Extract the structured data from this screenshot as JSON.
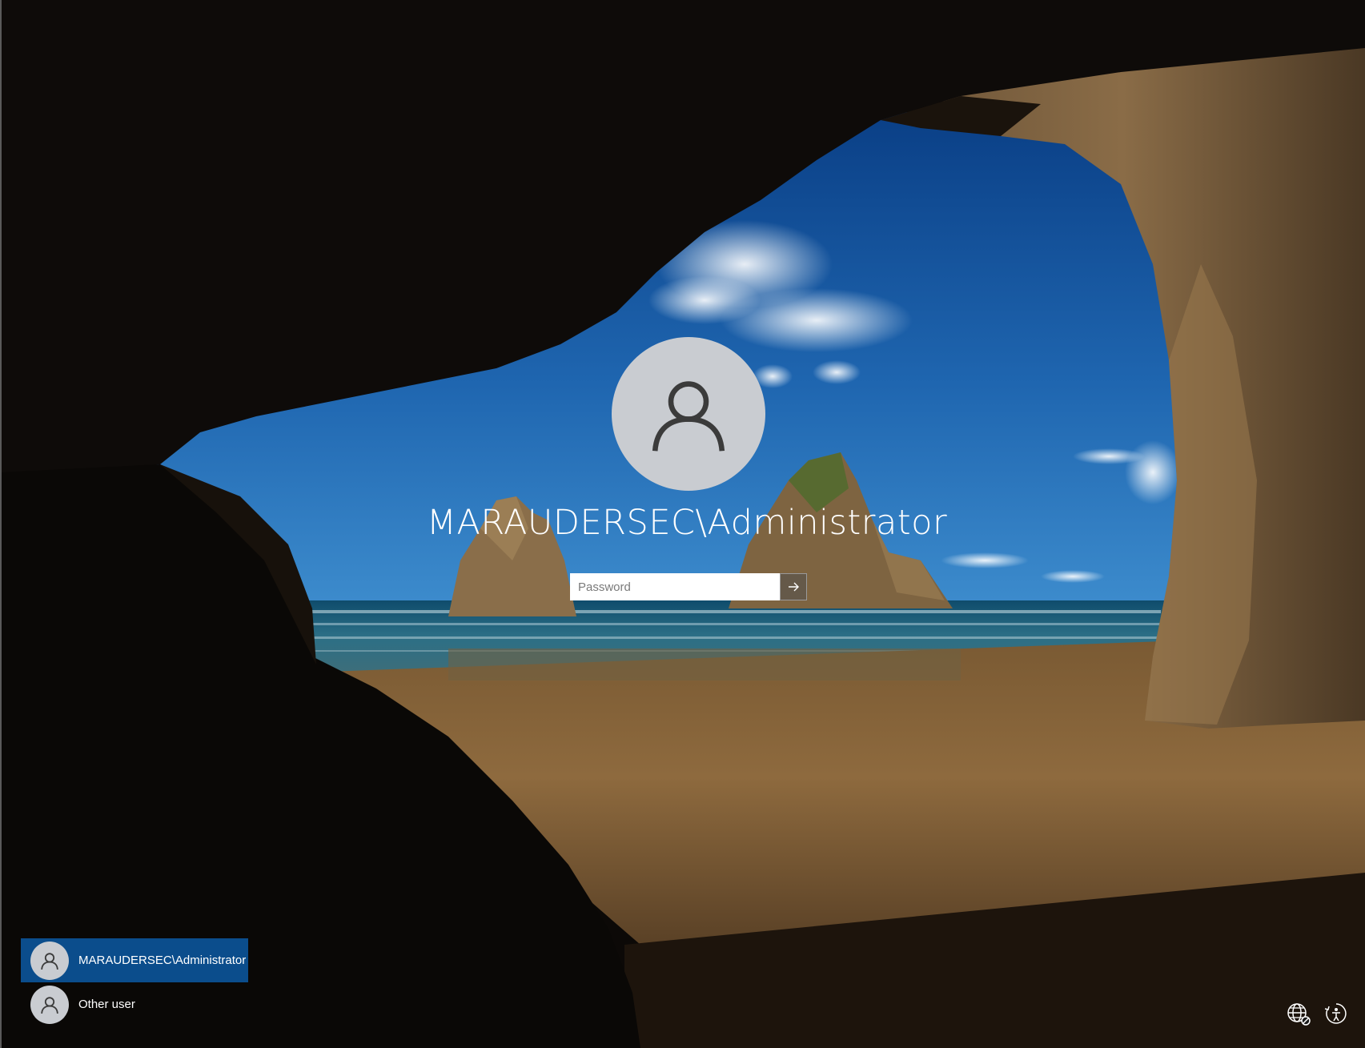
{
  "login": {
    "username": "MARAUDERSEC\\Administrator",
    "password_placeholder": "Password",
    "password_value": ""
  },
  "user_list": [
    {
      "label": "MARAUDERSEC\\Administrator",
      "selected": true
    },
    {
      "label": "Other user",
      "selected": false
    }
  ],
  "icons": {
    "avatar": "user-silhouette-icon",
    "submit": "arrow-right-icon",
    "network": "globe-network-icon",
    "ease_of_access": "ease-of-access-icon"
  },
  "colors": {
    "selected_user_bg": "#0b4d8c",
    "avatar_bg": "#c9ccd1",
    "text": "#ffffff"
  }
}
